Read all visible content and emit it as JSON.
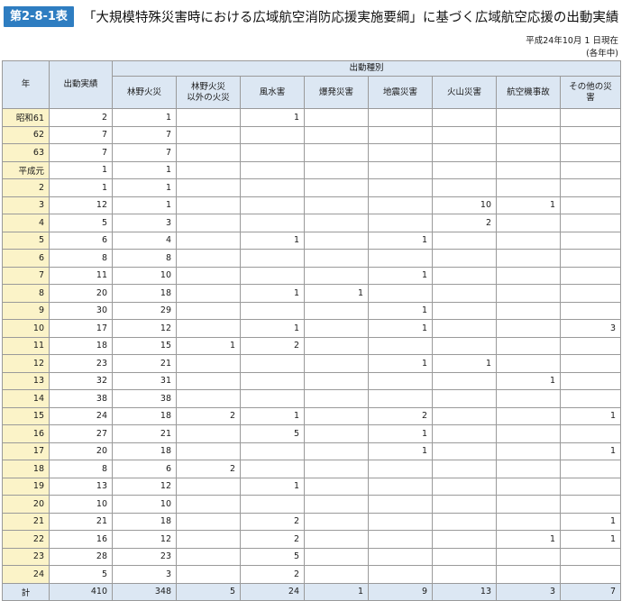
{
  "header": {
    "badge": "第2-8-1表",
    "title": "「大規模特殊災害時における広域航空消防応援実施要綱」に基づく広域航空応援の出動実績",
    "asof_line1": "平成24年10月 1 日現在",
    "asof_line2": "(各年中)"
  },
  "table": {
    "col_year": "年",
    "col_total": "出動実績",
    "group_label": "出動種別",
    "categories": [
      "林野火災",
      "林野火災\n以外の火災",
      "風水害",
      "爆発災害",
      "地震災害",
      "火山災害",
      "航空機事故",
      "その他の災害"
    ],
    "rows": [
      {
        "year": "昭和61",
        "total": "2",
        "values": [
          "1",
          "",
          "1",
          "",
          "",
          "",
          "",
          ""
        ]
      },
      {
        "year": "62",
        "total": "7",
        "values": [
          "7",
          "",
          "",
          "",
          "",
          "",
          "",
          ""
        ]
      },
      {
        "year": "63",
        "total": "7",
        "values": [
          "7",
          "",
          "",
          "",
          "",
          "",
          "",
          ""
        ]
      },
      {
        "year": "平成元",
        "total": "1",
        "values": [
          "1",
          "",
          "",
          "",
          "",
          "",
          "",
          ""
        ]
      },
      {
        "year": "2",
        "total": "1",
        "values": [
          "1",
          "",
          "",
          "",
          "",
          "",
          "",
          ""
        ]
      },
      {
        "year": "3",
        "total": "12",
        "values": [
          "1",
          "",
          "",
          "",
          "",
          "10",
          "1",
          ""
        ]
      },
      {
        "year": "4",
        "total": "5",
        "values": [
          "3",
          "",
          "",
          "",
          "",
          "2",
          "",
          ""
        ]
      },
      {
        "year": "5",
        "total": "6",
        "values": [
          "4",
          "",
          "1",
          "",
          "1",
          "",
          "",
          ""
        ]
      },
      {
        "year": "6",
        "total": "8",
        "values": [
          "8",
          "",
          "",
          "",
          "",
          "",
          "",
          ""
        ]
      },
      {
        "year": "7",
        "total": "11",
        "values": [
          "10",
          "",
          "",
          "",
          "1",
          "",
          "",
          ""
        ]
      },
      {
        "year": "8",
        "total": "20",
        "values": [
          "18",
          "",
          "1",
          "1",
          "",
          "",
          "",
          ""
        ]
      },
      {
        "year": "9",
        "total": "30",
        "values": [
          "29",
          "",
          "",
          "",
          "1",
          "",
          "",
          ""
        ]
      },
      {
        "year": "10",
        "total": "17",
        "values": [
          "12",
          "",
          "1",
          "",
          "1",
          "",
          "",
          "3"
        ]
      },
      {
        "year": "11",
        "total": "18",
        "values": [
          "15",
          "1",
          "2",
          "",
          "",
          "",
          "",
          ""
        ]
      },
      {
        "year": "12",
        "total": "23",
        "values": [
          "21",
          "",
          "",
          "",
          "1",
          "1",
          "",
          ""
        ]
      },
      {
        "year": "13",
        "total": "32",
        "values": [
          "31",
          "",
          "",
          "",
          "",
          "",
          "1",
          ""
        ]
      },
      {
        "year": "14",
        "total": "38",
        "values": [
          "38",
          "",
          "",
          "",
          "",
          "",
          "",
          ""
        ]
      },
      {
        "year": "15",
        "total": "24",
        "values": [
          "18",
          "2",
          "1",
          "",
          "2",
          "",
          "",
          "1"
        ]
      },
      {
        "year": "16",
        "total": "27",
        "values": [
          "21",
          "",
          "5",
          "",
          "1",
          "",
          "",
          ""
        ]
      },
      {
        "year": "17",
        "total": "20",
        "values": [
          "18",
          "",
          "",
          "",
          "1",
          "",
          "",
          "1"
        ]
      },
      {
        "year": "18",
        "total": "8",
        "values": [
          "6",
          "2",
          "",
          "",
          "",
          "",
          "",
          ""
        ]
      },
      {
        "year": "19",
        "total": "13",
        "values": [
          "12",
          "",
          "1",
          "",
          "",
          "",
          "",
          ""
        ]
      },
      {
        "year": "20",
        "total": "10",
        "values": [
          "10",
          "",
          "",
          "",
          "",
          "",
          "",
          ""
        ]
      },
      {
        "year": "21",
        "total": "21",
        "values": [
          "18",
          "",
          "2",
          "",
          "",
          "",
          "",
          "1"
        ]
      },
      {
        "year": "22",
        "total": "16",
        "values": [
          "12",
          "",
          "2",
          "",
          "",
          "",
          "1",
          "1"
        ]
      },
      {
        "year": "23",
        "total": "28",
        "values": [
          "23",
          "",
          "5",
          "",
          "",
          "",
          "",
          ""
        ]
      },
      {
        "year": "24",
        "total": "5",
        "values": [
          "3",
          "",
          "2",
          "",
          "",
          "",
          "",
          ""
        ]
      }
    ],
    "total_row": {
      "year": "計",
      "total": "410",
      "values": [
        "348",
        "5",
        "24",
        "1",
        "9",
        "13",
        "3",
        "7"
      ]
    }
  }
}
